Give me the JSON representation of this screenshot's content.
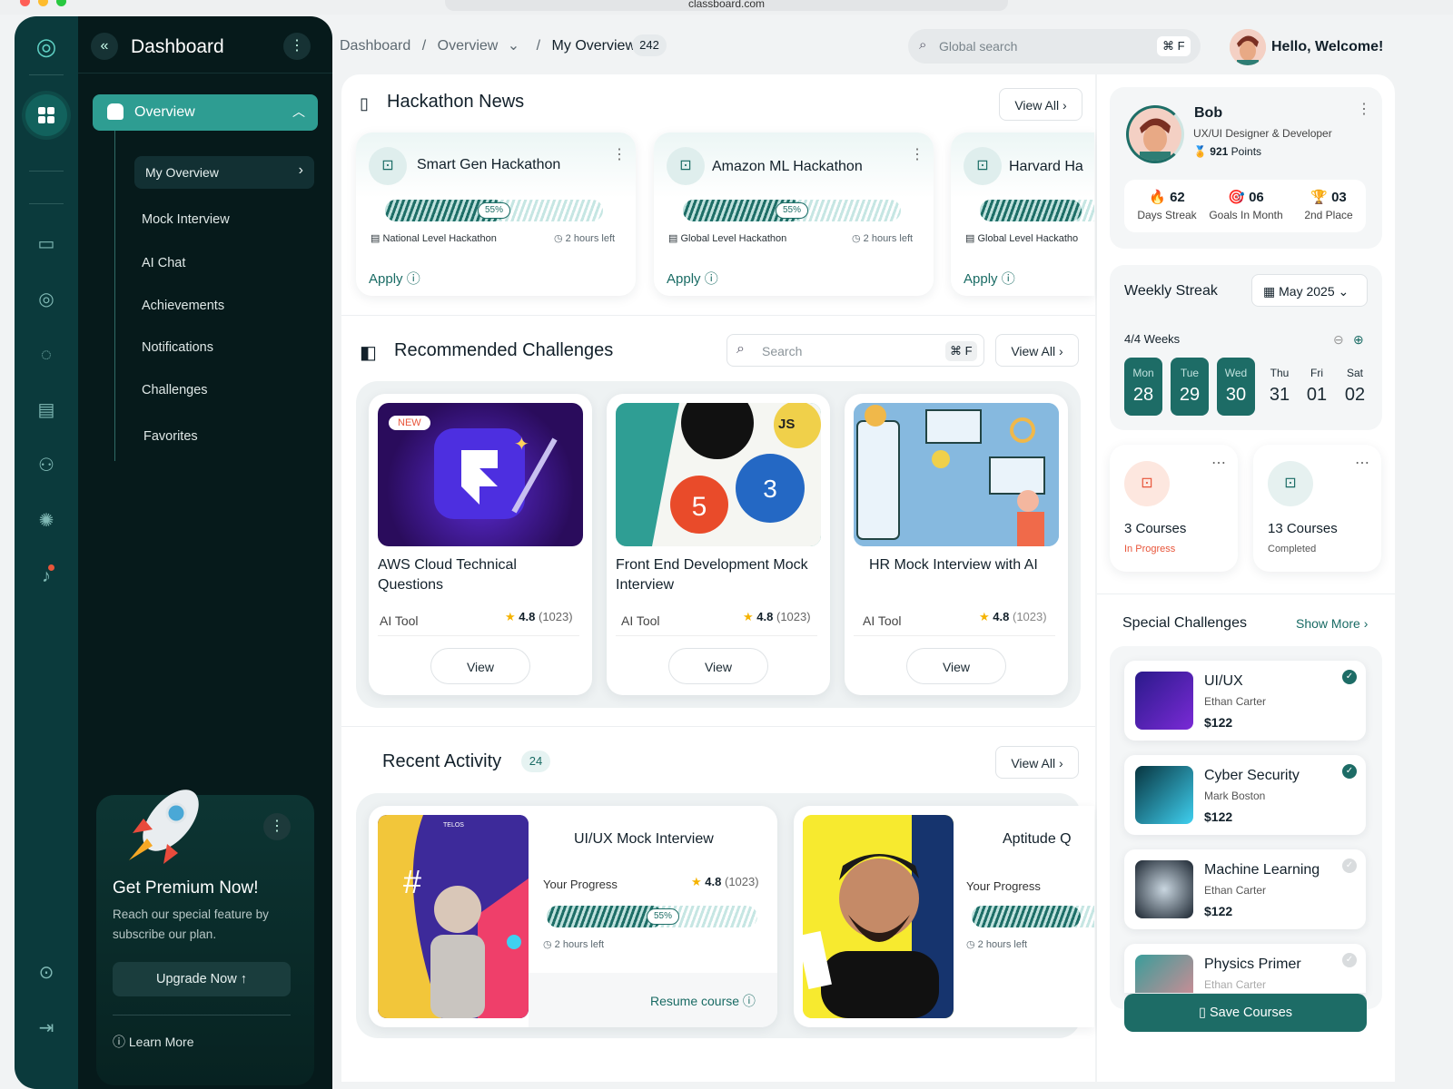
{
  "browser": {
    "url": "classboard.com"
  },
  "sidebar": {
    "title": "Dashboard",
    "overview": "Overview",
    "active_item": "My Overview",
    "items": [
      "Mock Interview",
      "AI Chat",
      "Achievements",
      "Notifications",
      "Challenges",
      "Favorites"
    ],
    "premium": {
      "title": "Get Premium Now!",
      "desc_line1": "Reach our special feature by",
      "desc_line2": "subscribe our plan.",
      "button": "Upgrade Now",
      "learn_more": "Learn More"
    }
  },
  "header": {
    "breadcrumb": [
      "Dashboard",
      "Overview",
      "My Overview"
    ],
    "count": "242",
    "search_placeholder": "Global search",
    "shortcut": "⌘ F",
    "greeting": "Hello, Welcome!"
  },
  "hackathon": {
    "title": "Hackathon News",
    "view_all": "View All",
    "cards": [
      {
        "name": "Smart Gen Hackathon",
        "progress": "55%",
        "level": "National Level Hackathon",
        "time": "2 hours left",
        "action": "Apply"
      },
      {
        "name": "Amazon ML Hackathon",
        "progress": "55%",
        "level": "Global Level Hackathon",
        "time": "2 hours left",
        "action": "Apply"
      },
      {
        "name": "Harvard Ha",
        "level": "Global Level Hackatho",
        "action": "Apply"
      }
    ]
  },
  "challenges": {
    "title": "Recommended Challenges",
    "search_placeholder": "Search",
    "shortcut": "⌘ F",
    "view_all": "View All",
    "cards": [
      {
        "badge": "NEW",
        "title_line1": "AWS Cloud Technical",
        "title_line2": "Questions",
        "tag": "AI Tool",
        "rating": "4.8",
        "reviews": "(1023)",
        "action": "View"
      },
      {
        "title_line1": "Front End Development Mock",
        "title_line2": "Interview",
        "tag": "AI Tool",
        "rating": "4.8",
        "reviews": "(1023)",
        "action": "View",
        "badge_js": "JS"
      },
      {
        "title_line1": "HR Mock Interview with AI",
        "title_line2": "",
        "tag": "AI Tool",
        "rating": "4.8",
        "reviews": "(1023)",
        "action": "View"
      }
    ]
  },
  "activity": {
    "title": "Recent Activity",
    "count": "24",
    "view_all": "View All",
    "cards": [
      {
        "title": "UI/UX Mock Interview",
        "progress_label": "Your Progress",
        "rating": "4.8",
        "reviews": "(1023)",
        "progress": "55%",
        "time": "2 hours left",
        "action": "Resume course",
        "logo": "TELOS"
      },
      {
        "title": "Aptitude Q",
        "progress_label": "Your Progress",
        "time": "2 hours left"
      }
    ]
  },
  "profile": {
    "name": "Bob",
    "role": "UX/UI Designer & Developer",
    "points": "921",
    "points_label": "Points",
    "stats": [
      {
        "value": "62",
        "label": "Days Streak",
        "icon": "🔥"
      },
      {
        "value": "06",
        "label": "Goals In Month",
        "icon": "🎯"
      },
      {
        "value": "03",
        "label": "2nd Place",
        "icon": "🏆"
      }
    ]
  },
  "streak": {
    "title": "Weekly Streak",
    "month": "May 2025",
    "weeks": "4/4 Weeks",
    "days": [
      {
        "n": "Mon",
        "d": "28",
        "active": true
      },
      {
        "n": "Tue",
        "d": "29",
        "active": true
      },
      {
        "n": "Wed",
        "d": "30",
        "active": true
      },
      {
        "n": "Thu",
        "d": "31",
        "active": false
      },
      {
        "n": "Fri",
        "d": "01",
        "active": false
      },
      {
        "n": "Sat",
        "d": "02",
        "active": false
      }
    ]
  },
  "courses": [
    {
      "title": "3 Courses",
      "status": "In Progress"
    },
    {
      "title": "13 Courses",
      "status": "Completed"
    }
  ],
  "special": {
    "title": "Special Challenges",
    "show_more": "Show More",
    "save": "Save Courses",
    "items": [
      {
        "title": "UI/UX",
        "author": "Ethan Carter",
        "price": "$122",
        "done": true
      },
      {
        "title": "Cyber Security",
        "author": "Mark Boston",
        "price": "$122",
        "done": true
      },
      {
        "title": "Machine Learning",
        "author": "Ethan Carter",
        "price": "$122",
        "done": false
      },
      {
        "title": "Physics Primer",
        "author": "Ethan Carter",
        "done": false
      }
    ]
  },
  "colors": {
    "primary": "#1e6e67",
    "dark": "#061a1b",
    "accent_orange": "#e8553a"
  }
}
